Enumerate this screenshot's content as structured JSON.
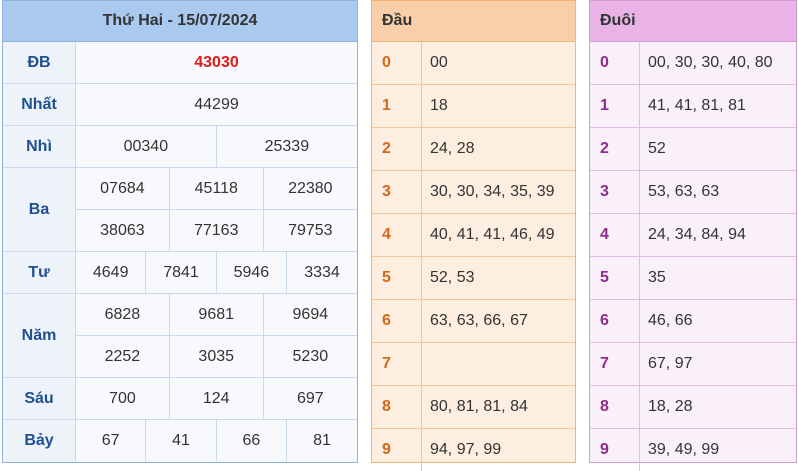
{
  "main": {
    "title": "Thứ Hai - 15/07/2024",
    "prizes": {
      "db": {
        "label": "ĐB",
        "values": [
          "43030"
        ]
      },
      "nhat": {
        "label": "Nhất",
        "values": [
          "44299"
        ]
      },
      "nhi": {
        "label": "Nhì",
        "values": [
          "00340",
          "25339"
        ]
      },
      "ba": {
        "label": "Ba",
        "values": [
          "07684",
          "45118",
          "22380",
          "38063",
          "77163",
          "79753"
        ]
      },
      "tu": {
        "label": "Tư",
        "values": [
          "4649",
          "7841",
          "5946",
          "3334"
        ]
      },
      "nam": {
        "label": "Năm",
        "values": [
          "6828",
          "9681",
          "9694",
          "2252",
          "3035",
          "5230"
        ]
      },
      "sau": {
        "label": "Sáu",
        "values": [
          "700",
          "124",
          "697"
        ]
      },
      "bay": {
        "label": "Bảy",
        "values": [
          "67",
          "41",
          "66",
          "81"
        ]
      }
    }
  },
  "dau": {
    "header": "Đầu",
    "rows": [
      {
        "k": "0",
        "v": "00"
      },
      {
        "k": "1",
        "v": "18"
      },
      {
        "k": "2",
        "v": "24, 28"
      },
      {
        "k": "3",
        "v": "30, 30, 34, 35, 39"
      },
      {
        "k": "4",
        "v": "40, 41, 41, 46, 49"
      },
      {
        "k": "5",
        "v": "52, 53"
      },
      {
        "k": "6",
        "v": "63, 63, 66, 67"
      },
      {
        "k": "7",
        "v": ""
      },
      {
        "k": "8",
        "v": "80, 81, 81, 84"
      },
      {
        "k": "9",
        "v": "94, 97, 99"
      }
    ]
  },
  "duoi": {
    "header": "Đuôi",
    "rows": [
      {
        "k": "0",
        "v": "00, 30, 30, 40, 80"
      },
      {
        "k": "1",
        "v": "41, 41, 81, 81"
      },
      {
        "k": "2",
        "v": "52"
      },
      {
        "k": "3",
        "v": "53, 63, 63"
      },
      {
        "k": "4",
        "v": "24, 34, 84, 94"
      },
      {
        "k": "5",
        "v": "35"
      },
      {
        "k": "6",
        "v": "46, 66"
      },
      {
        "k": "7",
        "v": "67, 97"
      },
      {
        "k": "8",
        "v": "18, 28"
      },
      {
        "k": "9",
        "v": "39, 49, 99"
      }
    ]
  }
}
